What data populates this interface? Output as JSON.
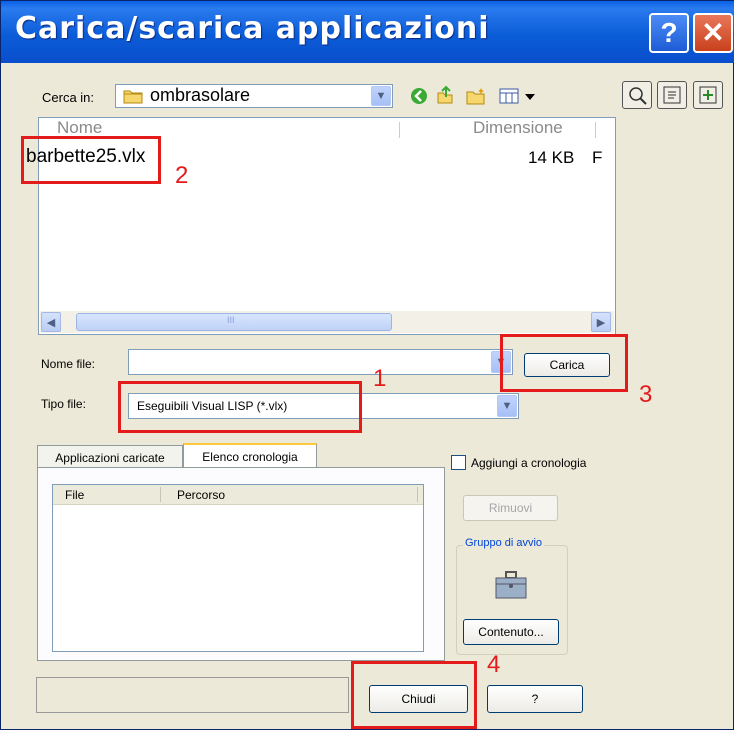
{
  "window": {
    "title": "Carica/scarica applicazioni",
    "help_icon": "?",
    "close_icon": "✕"
  },
  "lookin": {
    "label": "Cerca in:",
    "value": "ombrasolare"
  },
  "file_list": {
    "columns": [
      "Nome",
      "Dimensione"
    ],
    "items": [
      {
        "name": "barbette25.vlx",
        "size": "14 KB",
        "type_initial": "F"
      }
    ],
    "scroll_mark": "III"
  },
  "filename": {
    "label": "Nome file:",
    "value": "",
    "load_button": "Carica"
  },
  "filetype": {
    "label": "Tipo file:",
    "value": "Eseguibili Visual LISP (*.vlx)"
  },
  "tabs": [
    {
      "label": "Applicazioni caricate",
      "active": false
    },
    {
      "label": "Elenco cronologia",
      "active": true
    }
  ],
  "history_list": {
    "columns": [
      "File",
      "Percorso"
    ]
  },
  "history_checkbox": {
    "label": "Aggiungi a cronologia",
    "checked": false
  },
  "remove_button": "Rimuovi",
  "startup_group": {
    "label": "Gruppo di avvio",
    "contents_button": "Contenuto..."
  },
  "close_button": "Chiudi",
  "help_button": "?",
  "annotations": [
    {
      "label": "1",
      "color": "#E31B1B"
    },
    {
      "label": "2",
      "color": "#E31B1B"
    },
    {
      "label": "3",
      "color": "#E31B1B"
    },
    {
      "label": "4",
      "color": "#E31B1B"
    }
  ],
  "colors": {
    "titlebar": "#0A5FE6",
    "dialog_bg": "#ECE9D8",
    "annotation": "#E31B1B"
  }
}
